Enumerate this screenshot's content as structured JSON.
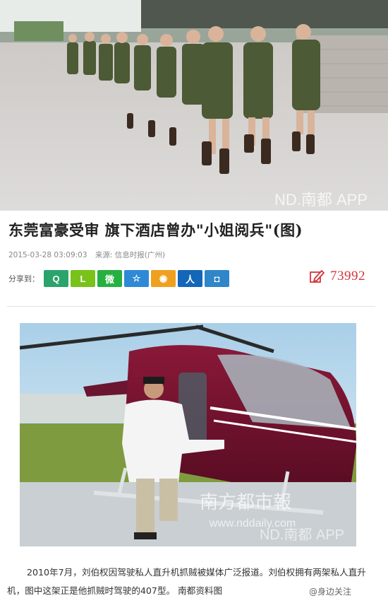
{
  "article": {
    "title": "东莞富豪受审 旗下酒店曾办\"小姐阅兵\"(图)",
    "datetime": "2015-03-28 03:09:03",
    "source": "来源: 信息时报(广州)",
    "share_label": "分享到：",
    "comment_count": "73992",
    "caption": "2010年7月，刘伯权因驾驶私人直升机抓贼被媒体广泛报道。刘伯权拥有两架私人直升机，图中这架正是他抓贼时驾驶的407型。 南都资料图",
    "weibo_watermark": "@身边关注"
  },
  "images": {
    "hero_watermark": "ND.南都 APP",
    "heli_watermark_paper": "南方都市報",
    "heli_watermark_url": "www.nddaily.com",
    "heli_watermark_app": "ND.南都 APP"
  },
  "share_buttons": [
    {
      "name": "qzone",
      "glyph": "Q"
    },
    {
      "name": "l",
      "glyph": "L"
    },
    {
      "name": "wechat",
      "glyph": "微"
    },
    {
      "name": "star",
      "glyph": "☆"
    },
    {
      "name": "weibo",
      "glyph": "◉"
    },
    {
      "name": "renren",
      "glyph": "人"
    },
    {
      "name": "tqq",
      "glyph": "◘"
    }
  ],
  "colors": {
    "accent_red": "#d6333a",
    "title": "#222222",
    "meta": "#888888"
  }
}
